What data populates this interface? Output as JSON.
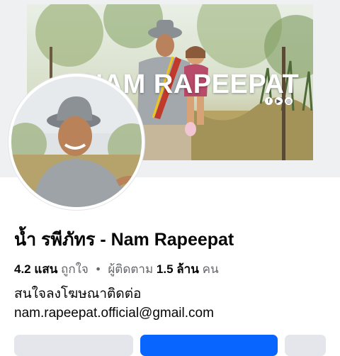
{
  "cover": {
    "title": "NAM RAPEEPAT",
    "social_icons": [
      "facebook-icon",
      "youtube-icon",
      "instagram-icon"
    ]
  },
  "profile": {
    "name": "น้ำ รพีภัทร - Nam Rapeepat",
    "likes_count": "4.2 แสน",
    "likes_label": "ถูกใจ",
    "followers_label": "ผู้ติดตาม",
    "followers_count": "1.5 ล้าน",
    "followers_unit": "คน",
    "bio_line1": "สนใจลงโฆษณาติดต่อ",
    "bio_line2": "nam.rapeepat.official@gmail.com"
  },
  "colors": {
    "primary_button": "#0866ff",
    "secondary_button": "#e4e6eb",
    "muted_text": "#65676b"
  }
}
